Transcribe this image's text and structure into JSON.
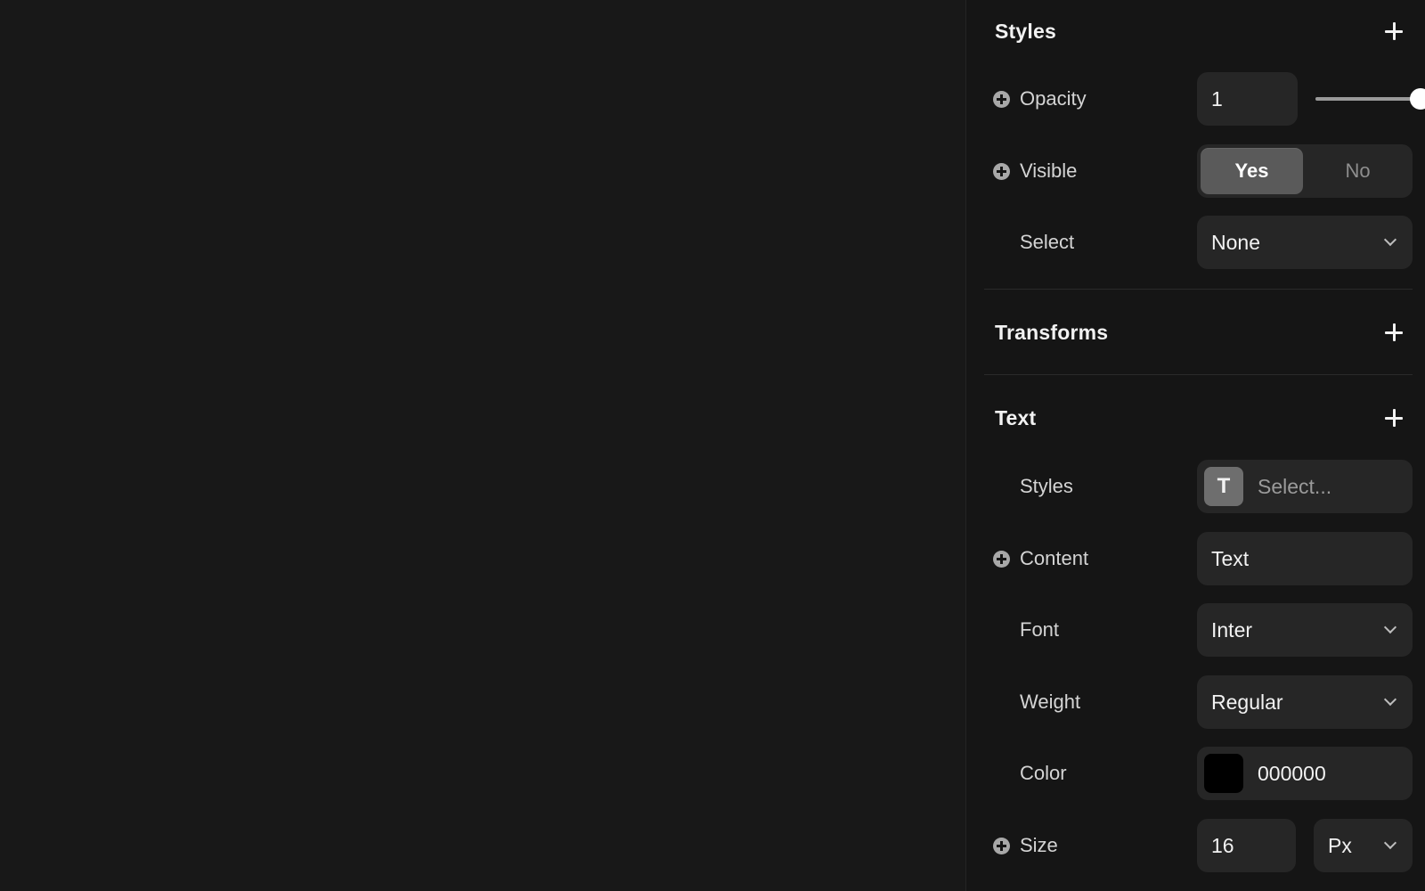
{
  "styles": {
    "title": "Styles",
    "opacity": {
      "label": "Opacity",
      "value": "1",
      "level": 1.0
    },
    "visible": {
      "label": "Visible",
      "options": [
        "Yes",
        "No"
      ],
      "selected": "Yes"
    },
    "select": {
      "label": "Select",
      "value": "None"
    }
  },
  "transforms": {
    "title": "Transforms"
  },
  "text": {
    "title": "Text",
    "styles": {
      "label": "Styles",
      "icon": "T",
      "placeholder": "Select..."
    },
    "content": {
      "label": "Content",
      "value": "Text"
    },
    "font": {
      "label": "Font",
      "value": "Inter"
    },
    "weight": {
      "label": "Weight",
      "value": "Regular"
    },
    "color": {
      "label": "Color",
      "value": "000000",
      "swatch": "#000000"
    },
    "size": {
      "label": "Size",
      "value": "16",
      "unit": "Px"
    }
  }
}
